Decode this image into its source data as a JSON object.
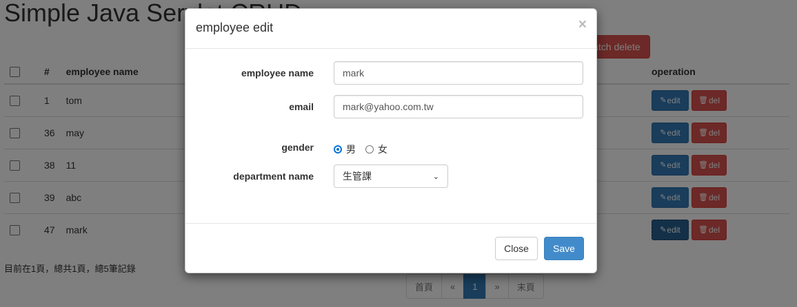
{
  "page": {
    "title": "Simple Java Servlet CRUD",
    "batch_delete_label": "batch delete",
    "table": {
      "headers": {
        "num": "#",
        "name": "employee name",
        "operation": "operation"
      },
      "rows": [
        {
          "id": "1",
          "name": "tom"
        },
        {
          "id": "36",
          "name": "may"
        },
        {
          "id": "38",
          "name": "11"
        },
        {
          "id": "39",
          "name": "abc"
        },
        {
          "id": "47",
          "name": "mark"
        }
      ],
      "edit_label": "edit",
      "del_label": "del"
    },
    "page_info": "目前在1頁，總共1頁，總5筆記錄",
    "pagination": {
      "first": "首頁",
      "prev": "«",
      "current": "1",
      "next": "»",
      "last": "末頁"
    }
  },
  "modal": {
    "title": "employee edit",
    "close_icon": "×",
    "fields": {
      "name_label": "employee name",
      "name_value": "mark",
      "email_label": "email",
      "email_value": "mark@yahoo.com.tw",
      "gender_label": "gender",
      "gender_options": [
        "男",
        "女"
      ],
      "gender_selected": "男",
      "department_label": "department name",
      "department_value": "生管課"
    },
    "close_button": "Close",
    "save_button": "Save"
  },
  "colors": {
    "primary": "#337ab7",
    "danger": "#d9534f",
    "save": "#428bca"
  }
}
